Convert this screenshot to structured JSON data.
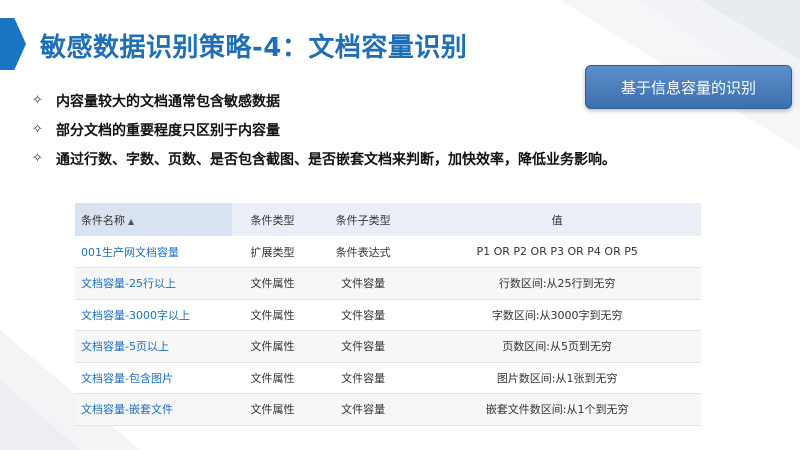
{
  "title": "敏感数据识别策略-4：文档容量识别",
  "badge": "基于信息容量的识别",
  "bullets": [
    "内容量较大的文档通常包含敏感数据",
    "部分文档的重要程度只区别于内容量",
    "通过行数、字数、页数、是否包含截图、是否嵌套文档来判断，加快效率，降低业务影响。"
  ],
  "icons": {
    "bullet": "diamond-bullet-icon",
    "sort": "sort-asc-icon",
    "left": "chevron-right-icon"
  },
  "colors": {
    "title": "#1f6fb8",
    "link": "#1a6fc4",
    "badge": "#4a7dbd"
  },
  "table": {
    "headers": [
      "条件名称",
      "条件类型",
      "条件子类型",
      "值"
    ],
    "rows": [
      [
        "001生产网文档容量",
        "扩展类型",
        "条件表达式",
        "P1 OR P2 OR P3 OR P4 OR P5"
      ],
      [
        "文档容量-25行以上",
        "文件属性",
        "文件容量",
        "行数区间:从25行到无穷"
      ],
      [
        "文档容量-3000字以上",
        "文件属性",
        "文件容量",
        "字数区间:从3000字到无穷"
      ],
      [
        "文档容量-5页以上",
        "文件属性",
        "文件容量",
        "页数区间:从5页到无穷"
      ],
      [
        "文档容量-包含图片",
        "文件属性",
        "文件容量",
        "图片数区间:从1张到无穷"
      ],
      [
        "文档容量-嵌套文件",
        "文件属性",
        "文件容量",
        "嵌套文件数区间:从1个到无穷"
      ]
    ]
  }
}
